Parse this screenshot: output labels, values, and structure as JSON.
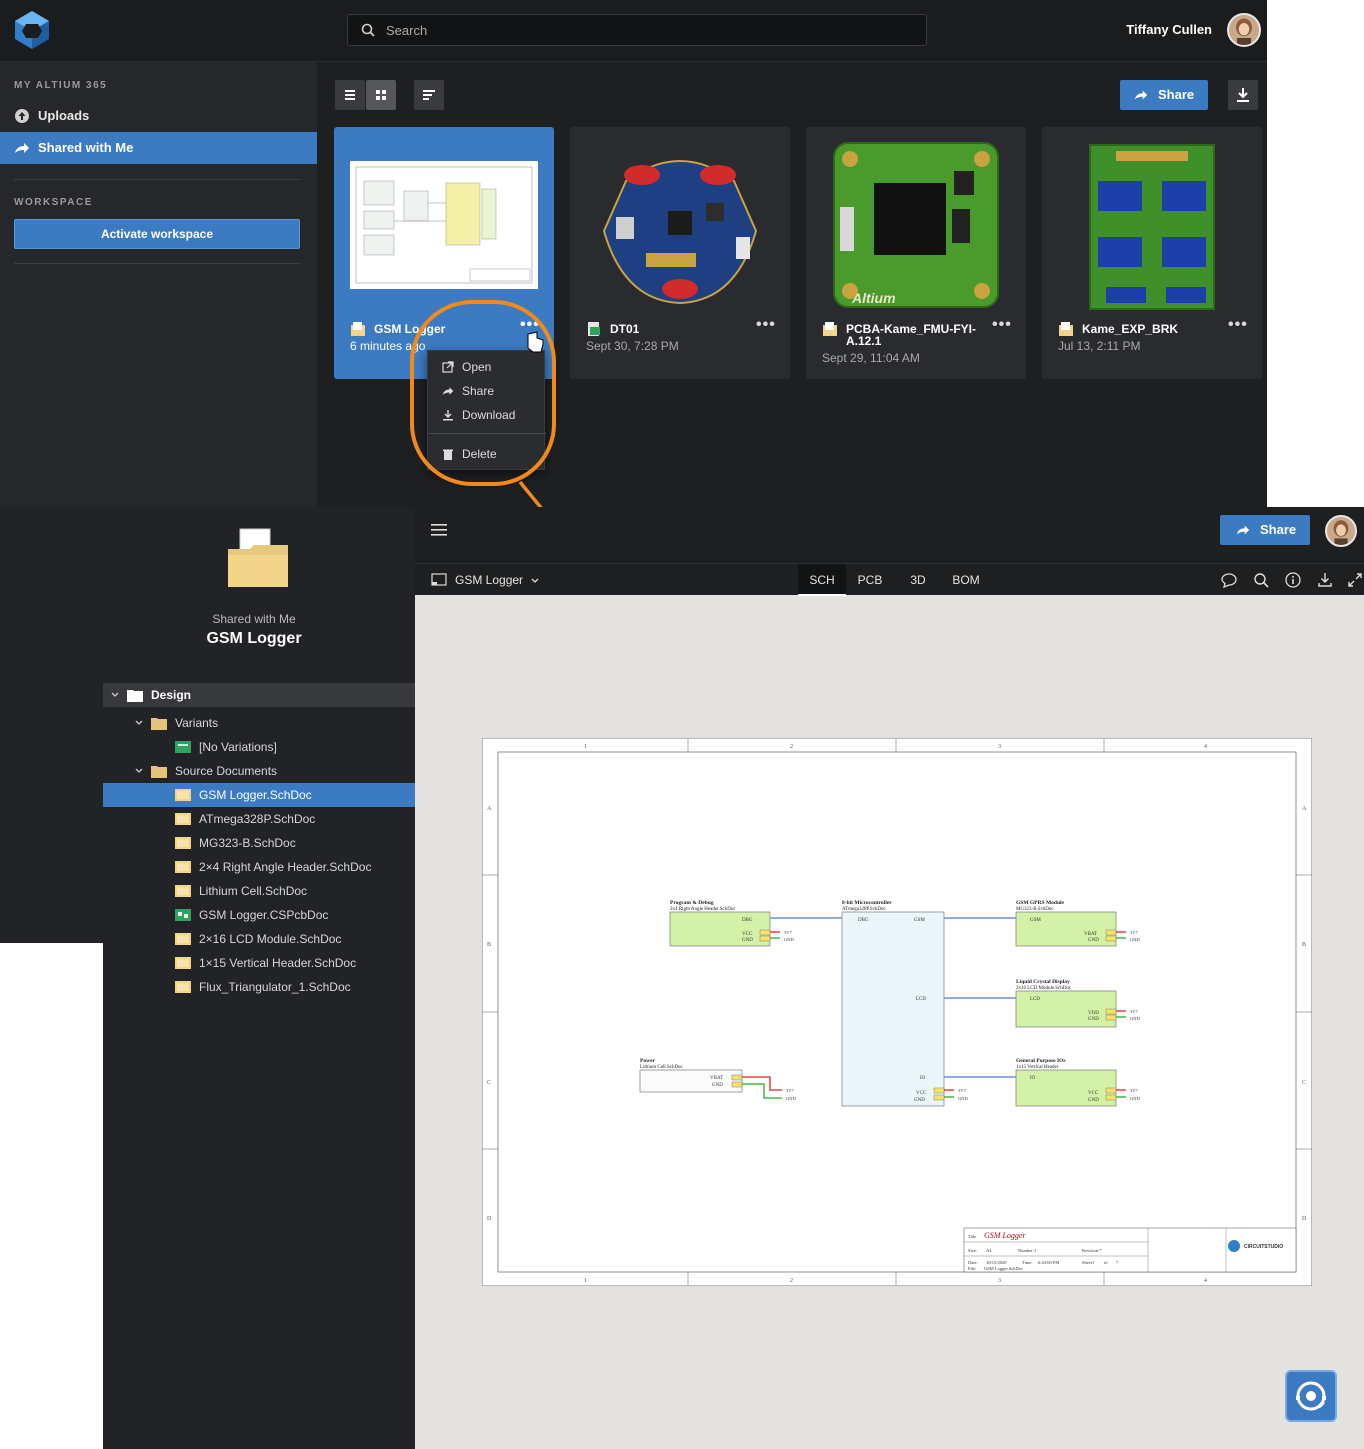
{
  "topbar": {
    "search_placeholder": "Search",
    "user_name": "Tiffany Cullen"
  },
  "leftnav": {
    "section1": "MY ALTIUM 365",
    "items": [
      {
        "label": "Uploads",
        "icon": "upload-icon"
      },
      {
        "label": "Shared with Me",
        "icon": "shared-icon"
      }
    ],
    "section2": "WORKSPACE",
    "activate_label": "Activate workspace"
  },
  "toolbar": {
    "share_label": "Share"
  },
  "cards": [
    {
      "name": "GSM Logger",
      "date": "6 minutes ago",
      "icon": "project-folder-icon",
      "selected": true
    },
    {
      "name": "DT01",
      "date": "Sept 30, 7:28 PM",
      "icon": "pcb-project-icon",
      "selected": false
    },
    {
      "name": "PCBA-Kame_FMU-FYI-A.12.1",
      "date": "Sept 29, 11:04 AM",
      "icon": "project-folder-icon",
      "selected": false
    },
    {
      "name": "Kame_EXP_BRK",
      "date": "Jul 13, 2:11 PM",
      "icon": "project-folder-icon",
      "selected": false
    }
  ],
  "context_menu": {
    "items": [
      "Open",
      "Share",
      "Download",
      "Delete"
    ]
  },
  "project": {
    "shared_label": "Shared with Me",
    "title": "GSM Logger"
  },
  "tree": [
    {
      "label": "Design",
      "level": 0,
      "type": "folder"
    },
    {
      "label": "Variants",
      "level": 1,
      "type": "folder"
    },
    {
      "label": "[No Variations]",
      "level": 2,
      "type": "variant"
    },
    {
      "label": "Source Documents",
      "level": 1,
      "type": "folder"
    },
    {
      "label": "GSM Logger.SchDoc",
      "level": 2,
      "type": "sch",
      "selected": true
    },
    {
      "label": "ATmega328P.SchDoc",
      "level": 2,
      "type": "sch"
    },
    {
      "label": "MG323-B.SchDoc",
      "level": 2,
      "type": "sch"
    },
    {
      "label": "2×4 Right Angle Header.SchDoc",
      "level": 2,
      "type": "sch"
    },
    {
      "label": "Lithium Cell.SchDoc",
      "level": 2,
      "type": "sch"
    },
    {
      "label": "GSM Logger.CSPcbDoc",
      "level": 2,
      "type": "pcb"
    },
    {
      "label": "2×16 LCD Module.SchDoc",
      "level": 2,
      "type": "sch"
    },
    {
      "label": "1×15 Vertical Header.SchDoc",
      "level": 2,
      "type": "sch"
    },
    {
      "label": "Flux_Triangulator_1.SchDoc",
      "level": 2,
      "type": "sch"
    }
  ],
  "viewer": {
    "share_label": "Share",
    "document": "GSM Logger",
    "tabs": [
      "SCH",
      "PCB",
      "3D",
      "BOM"
    ],
    "active_tab": "SCH",
    "toolbar_icons": [
      "comment-icon",
      "search-icon",
      "info-icon",
      "download-icon",
      "fullscreen-icon"
    ]
  },
  "schematic": {
    "border_cols": [
      "1",
      "2",
      "3",
      "4"
    ],
    "border_rows": [
      "A",
      "B",
      "C",
      "D"
    ],
    "blocks": [
      {
        "title": "Program & Debug",
        "file": "2x4 Right Angle Header.SchDoc",
        "pins": [
          "DBG",
          "VCC",
          "GND"
        ]
      },
      {
        "title": "8-bit Microcontroller",
        "file": "ATmega328P.SchDoc",
        "pins": [
          "DBG",
          "GSM",
          "LCD",
          "IO",
          "VCC",
          "GND"
        ]
      },
      {
        "title": "GSM GPRS Module",
        "file": "MG323-B.SchDoc",
        "pins": [
          "GSM",
          "VBAT",
          "GND"
        ]
      },
      {
        "title": "Liquid Crystal Display",
        "file": "2x16 LCD Module.SchDoc",
        "pins": [
          "LCD",
          "VDD",
          "GND"
        ]
      },
      {
        "title": "General Purpose IOs",
        "file": "1x15 Vertical Header",
        "pins": [
          "IO",
          "VCC",
          "GND"
        ]
      },
      {
        "title": "Power",
        "file": "Lithium Cell.SchDoc",
        "pins": [
          "VBAT",
          "GND"
        ]
      }
    ],
    "net_labels": [
      "3V7",
      "GND"
    ],
    "title_block": {
      "title_label": "Title",
      "title": "GSM Logger",
      "size_label": "Size:",
      "size": "A4",
      "number_label": "Number:1",
      "revision_label": "Revision:*",
      "date_label": "Date:",
      "date": "10/15/2020",
      "time_label": "Time:",
      "time": "6:43:00 PM",
      "sheet": "Sheet1",
      "of": "of",
      "sheet_total": "7",
      "file_label": "File:",
      "file": "GSM Logger.SchDoc",
      "logo_text": "CIRCUITSTUDIO"
    }
  },
  "colors": {
    "accent": "#3c7ac2",
    "callout": "#f08a1c",
    "sheet_block": "#d3f2a8"
  }
}
